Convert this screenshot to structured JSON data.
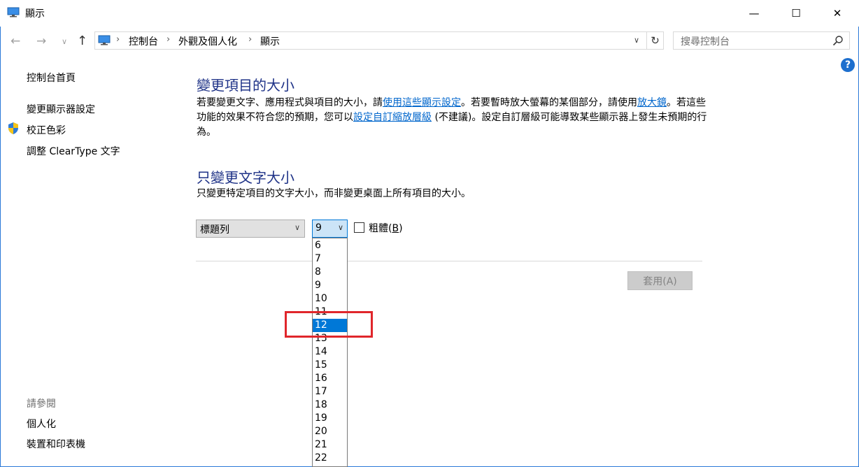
{
  "window": {
    "title": "顯示",
    "minimize_glyph": "—",
    "maximize_glyph": "☐",
    "close_glyph": "✕"
  },
  "address": {
    "breadcrumbs": [
      "控制台",
      "外觀及個人化",
      "顯示"
    ],
    "search_placeholder": "搜尋控制台"
  },
  "help": {
    "label": "?"
  },
  "sidebar": {
    "home": "控制台首頁",
    "items": [
      "變更顯示器設定",
      "校正色彩",
      "調整 ClearType 文字"
    ],
    "see_also_title": "請參閱",
    "see_also": [
      "個人化",
      "裝置和印表機"
    ]
  },
  "main": {
    "section1_title": "變更項目的大小",
    "section1_text_a": "若要變更文字、應用程式與項目的大小，請",
    "section1_link1": "使用這些顯示設定",
    "section1_text_b": "。若要暫時放大螢幕的某個部分，請使用",
    "section1_link2": "放大鏡",
    "section1_text_c": "。若這些功能的效果不符合您的預期，您可以",
    "section1_link3": "設定自訂縮放層級",
    "section1_text_d": " (不建議)。設定自訂層級可能導致某些顯示器上發生未預期的行為。",
    "section2_title": "只變更文字大小",
    "section2_text": "只變更特定項目的文字大小，而非變更桌面上所有項目的大小。",
    "item_select_value": "標題列",
    "size_select_value": "9",
    "bold_label_prefix": "粗體(",
    "bold_label_key": "B",
    "bold_label_suffix": ")",
    "bold_checked": false,
    "apply_label": "套用(A)"
  },
  "size_options": [
    "6",
    "7",
    "8",
    "9",
    "10",
    "11",
    "12",
    "13",
    "14",
    "15",
    "16",
    "17",
    "18",
    "19",
    "20",
    "21",
    "22"
  ],
  "size_selected": "12",
  "colors": {
    "heading": "#1e3287",
    "link": "#0066cc",
    "selection": "#0078d7",
    "annotation": "#e0262b"
  }
}
